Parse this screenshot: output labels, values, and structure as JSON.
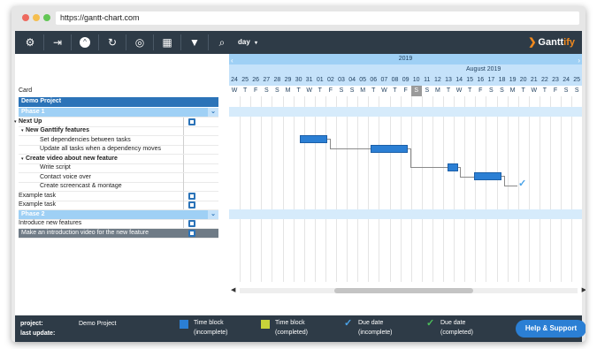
{
  "browser": {
    "url": "https://gantt-chart.com",
    "dot_colors": [
      "#ee6a5f",
      "#f5be4f",
      "#62c655"
    ]
  },
  "toolbar": {
    "view_label": "day",
    "brand_name": "Gantt",
    "brand_accent": "ify",
    "icons": [
      "gears-icon",
      "export-icon",
      "collapse-up-icon",
      "refresh-icon",
      "target-icon",
      "calendar-icon",
      "filter-icon",
      "search-icon"
    ]
  },
  "tree": {
    "card_header": "Card",
    "project": "Demo Project",
    "rows": [
      {
        "label": "Phase 1",
        "kind": "phase",
        "chevron": "⌄"
      },
      {
        "label": "Next Up",
        "kind": "group",
        "bold": true,
        "note": true
      },
      {
        "label": "New Ganttify features",
        "kind": "subgroup",
        "bold": true
      },
      {
        "label": "Set dependencies between tasks",
        "kind": "task"
      },
      {
        "label": "Update all tasks when a dependency moves",
        "kind": "task"
      },
      {
        "label": "Create video about new feature",
        "kind": "subgroup",
        "bold": true
      },
      {
        "label": "Write script",
        "kind": "task"
      },
      {
        "label": "Contact voice over",
        "kind": "task"
      },
      {
        "label": "Create screencast & montage",
        "kind": "task"
      },
      {
        "label": "Example task",
        "kind": "plain",
        "note": true
      },
      {
        "label": "Example task",
        "kind": "plain",
        "note": true
      },
      {
        "label": "Phase 2",
        "kind": "phase",
        "chevron": "⌄"
      },
      {
        "label": "Introduce new features",
        "kind": "plain",
        "note": true
      },
      {
        "label": "Make an introduction video for the new feature",
        "kind": "dark",
        "note": true
      }
    ]
  },
  "timeline": {
    "year": "2019",
    "month": "August 2019",
    "days": [
      "24",
      "25",
      "26",
      "27",
      "28",
      "29",
      "30",
      "31",
      "01",
      "02",
      "03",
      "04",
      "05",
      "06",
      "07",
      "08",
      "09",
      "10",
      "11",
      "12",
      "13",
      "14",
      "15",
      "16",
      "17",
      "18",
      "19",
      "20",
      "21",
      "22",
      "23",
      "24",
      "25"
    ],
    "weekdays": [
      "W",
      "T",
      "F",
      "S",
      "S",
      "M",
      "T",
      "W",
      "T",
      "F",
      "S",
      "S",
      "M",
      "T",
      "W",
      "T",
      "F",
      "S",
      "S",
      "M",
      "T",
      "W",
      "T",
      "F",
      "S",
      "S",
      "M",
      "T",
      "W",
      "T",
      "F",
      "S",
      "S"
    ],
    "today_index": 17
  },
  "footer": {
    "project_label": "project:",
    "project_value": "Demo Project",
    "last_update_label": "last update:",
    "legend": [
      {
        "line1": "Time block",
        "line2": "(incomplete)",
        "color": "#2b7fd4",
        "kind": "square"
      },
      {
        "line1": "Time block",
        "line2": "(completed)",
        "color": "#c8d23a",
        "kind": "square"
      },
      {
        "line1": "Due date",
        "line2": "(incomplete)",
        "color": "#4aa3e8",
        "kind": "check"
      },
      {
        "line1": "Due date",
        "line2": "(completed)",
        "color": "#4cbf5a",
        "kind": "check"
      }
    ],
    "help_button": "Help & Support"
  }
}
